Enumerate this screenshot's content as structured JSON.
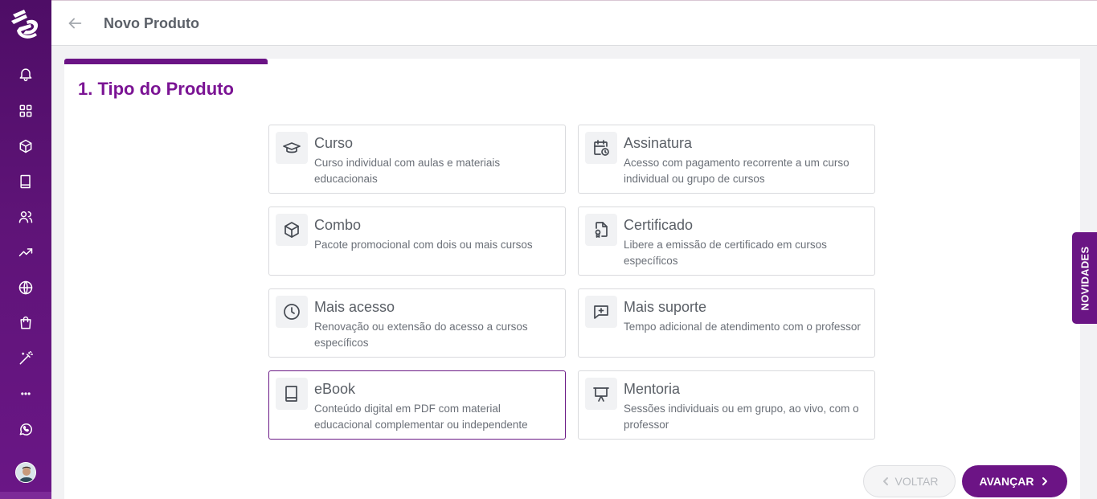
{
  "header": {
    "title": "Novo Produto"
  },
  "step": {
    "title": "1. Tipo do Produto",
    "progress_fraction": 0.2
  },
  "product_types": [
    {
      "title": "Curso",
      "description": "Curso individual com aulas e materiais educacionais",
      "icon": "graduation-cap-icon"
    },
    {
      "title": "Assinatura",
      "description": "Acesso com pagamento recorrente a um curso individual ou grupo de cursos",
      "icon": "calendar-clock-icon"
    },
    {
      "title": "Combo",
      "description": "Pacote promocional com dois ou mais cursos",
      "icon": "package-icon"
    },
    {
      "title": "Certificado",
      "description": "Libere a emissão de certificado em cursos específicos",
      "icon": "certificate-icon"
    },
    {
      "title": "Mais acesso",
      "description": "Renovação ou extensão do acesso a cursos específicos",
      "icon": "clock-icon"
    },
    {
      "title": "Mais suporte",
      "description": "Tempo adicional de atendimento com o professor",
      "icon": "message-plus-icon"
    },
    {
      "title": "eBook",
      "description": "Conteúdo digital em PDF com material educacional complementar ou independente",
      "icon": "book-icon",
      "selected": true
    },
    {
      "title": "Mentoria",
      "description": "Sessões individuais ou em grupo, ao vivo, com o professor",
      "icon": "presentation-icon"
    }
  ],
  "buttons": {
    "back": "VOLTAR",
    "next": "AVANÇAR"
  },
  "side_tab": {
    "label": "NOVIDADES"
  },
  "colors": {
    "brand": "#6c1485",
    "sidebar": "#5a1272",
    "title": "#7b1494"
  }
}
